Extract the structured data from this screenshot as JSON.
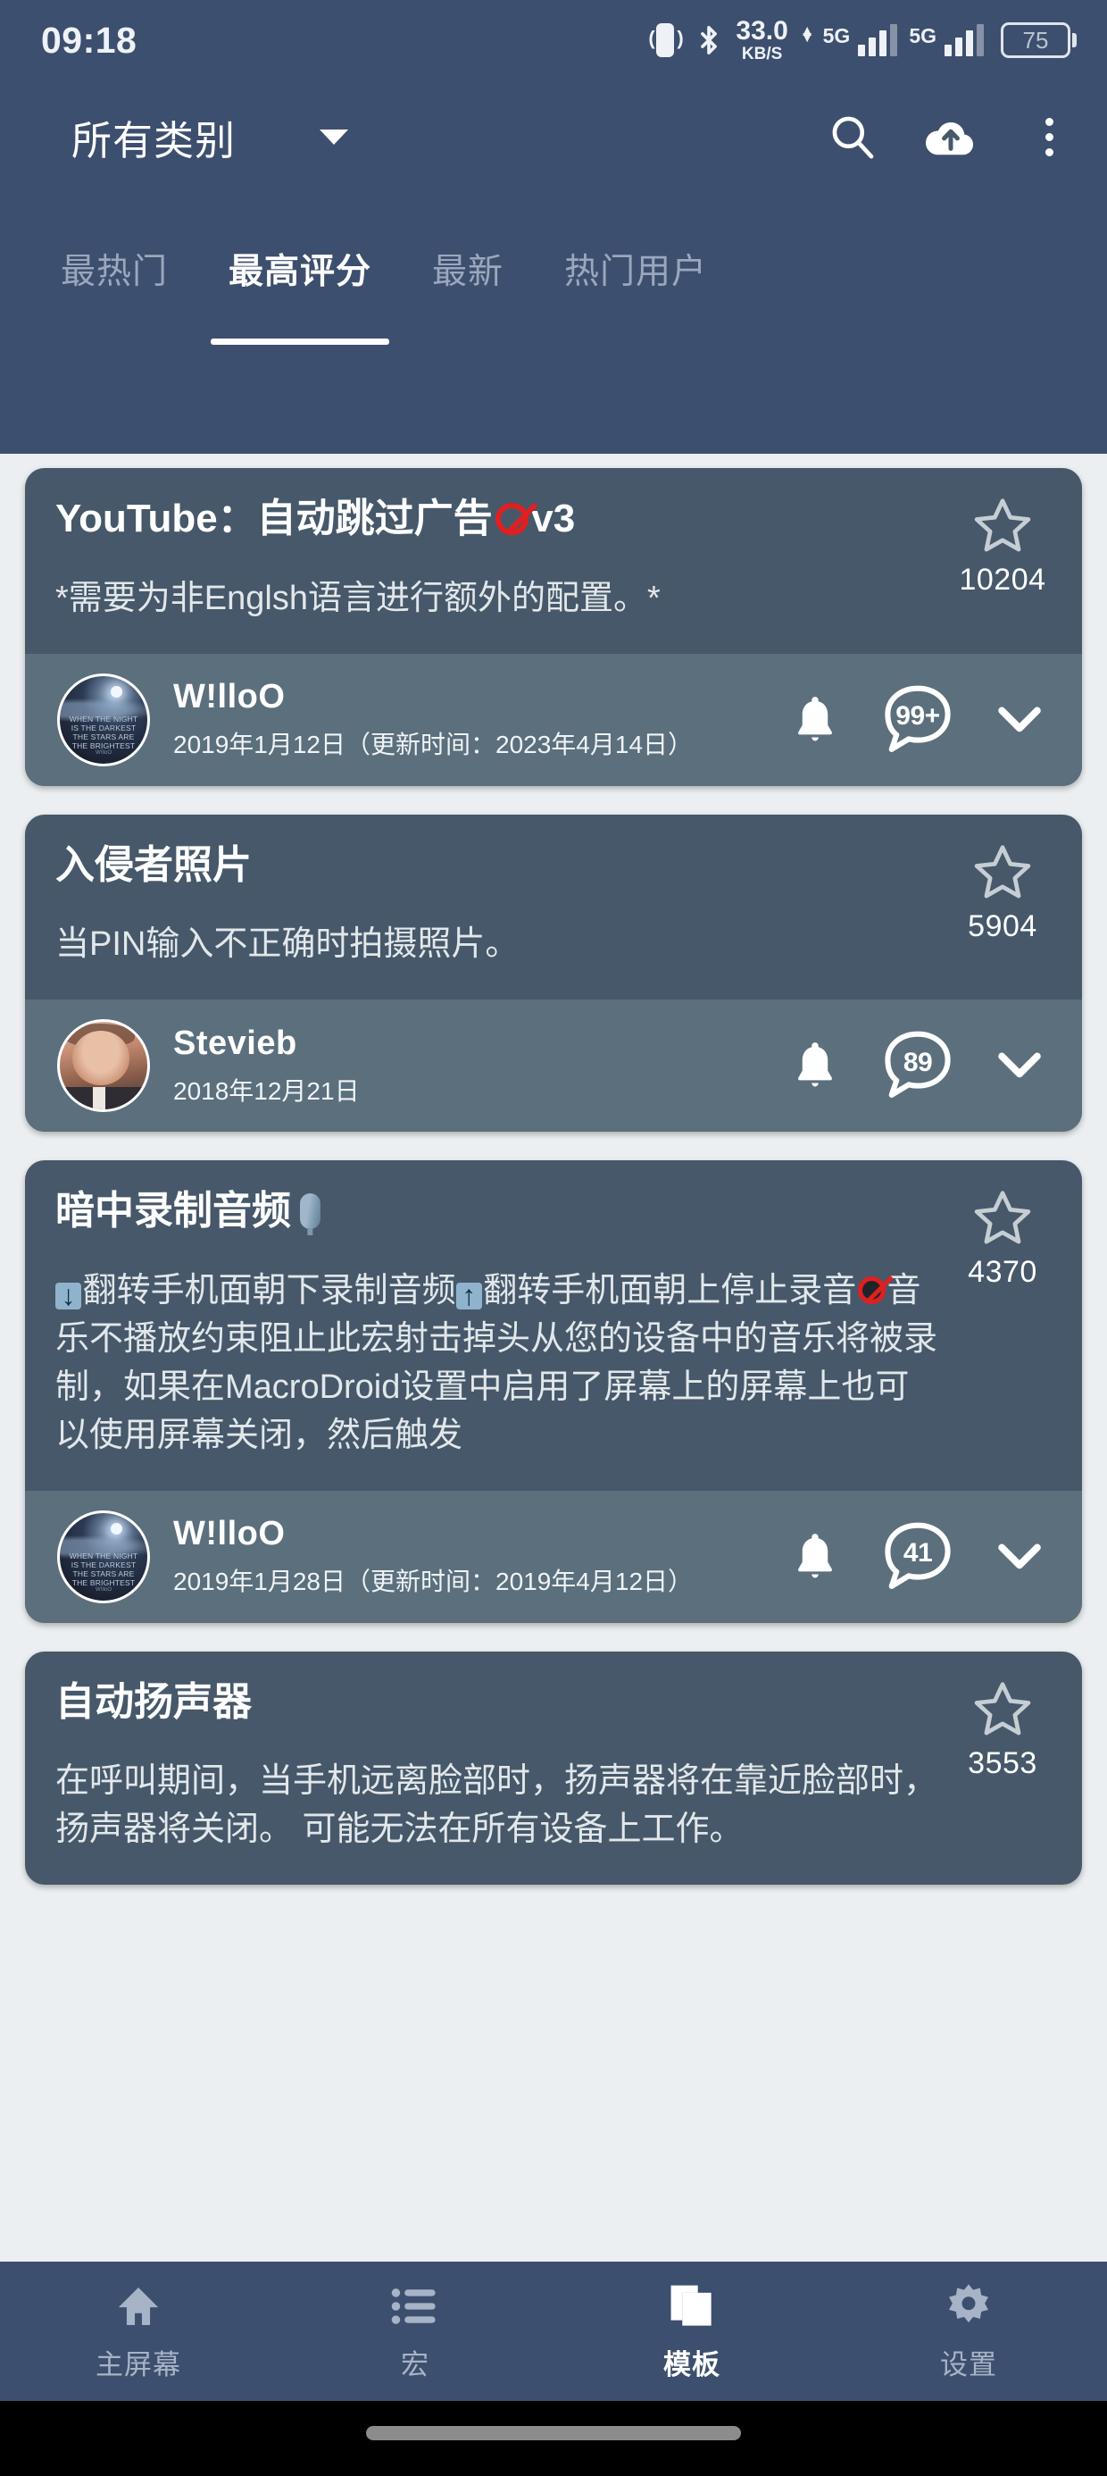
{
  "status_bar": {
    "clock": "09:18",
    "network_speed_value": "33.0",
    "network_speed_unit": "KB/S",
    "sim1_network": "5G",
    "sim2_network": "5G",
    "battery_percent": "75",
    "icons": [
      "vibrate-icon",
      "bluetooth-icon",
      "signal-icon",
      "battery-icon"
    ]
  },
  "toolbar": {
    "category": "所有类别",
    "dropdown_icon": "chevron-down-icon",
    "search_icon": "search-icon",
    "upload_icon": "cloud-upload-icon",
    "overflow_icon": "more-vertical-icon"
  },
  "tabs": [
    {
      "label": "最热门",
      "active": false
    },
    {
      "label": "最高评分",
      "active": true
    },
    {
      "label": "最新",
      "active": false
    },
    {
      "label": "热门用户",
      "active": false
    }
  ],
  "cards": [
    {
      "title_parts": [
        {
          "type": "text",
          "value": "YouTube：自动跳过广告"
        },
        {
          "type": "emoji",
          "value": "no-entry-emoji"
        },
        {
          "type": "text",
          "value": "v3"
        }
      ],
      "title_plain": "YouTube：自动跳过广告🚫v3",
      "description": "*需要为非Englsh语言进行额外的配置。*",
      "rating_icon": "star-outline-icon",
      "rating_count": "10204",
      "author": {
        "name": "W!lloO",
        "avatar": "night-sky-avatar",
        "avatar_caption": "WHEN THE NIGHT IS THE DARKEST THE STARS ARE THE BRIGHTEST",
        "date": "2019年1月12日（更新时间：2023年4月14日）",
        "bell_icon": "bell-icon",
        "comment_icon": "comment-bubble-icon",
        "comment_count": "99+",
        "expand_icon": "chevron-down-icon"
      }
    },
    {
      "title_parts": [
        {
          "type": "text",
          "value": "入侵者照片"
        }
      ],
      "title_plain": "入侵者照片",
      "description": "当PIN输入不正确时拍摄照片。",
      "rating_icon": "star-outline-icon",
      "rating_count": "5904",
      "author": {
        "name": "Stevieb",
        "avatar": "photo-avatar",
        "date": "2018年12月21日",
        "bell_icon": "bell-icon",
        "comment_icon": "comment-bubble-icon",
        "comment_count": "89",
        "expand_icon": "chevron-down-icon"
      }
    },
    {
      "title_parts": [
        {
          "type": "text",
          "value": "暗中录制音频"
        },
        {
          "type": "emoji",
          "value": "microphone-emoji"
        }
      ],
      "title_plain": "暗中录制音频🎙",
      "description": "⤵翻转手机面朝下录制音频⤴翻转手机面朝上停止录音🚫音乐不播放约束阻止此宏射击掉头从您的设备中的音乐将被录制，如果在MacroDroid设置中启用了屏幕上的屏幕上也可以使用屏幕关闭，然后触发",
      "description_parts": [
        {
          "type": "emoji",
          "value": "arrow-down-emoji",
          "glyph": "↓"
        },
        {
          "type": "text",
          "value": "翻转手机面朝下录制音频"
        },
        {
          "type": "emoji",
          "value": "arrow-up-emoji",
          "glyph": "↑"
        },
        {
          "type": "text",
          "value": "翻转手机面朝上停止录音"
        },
        {
          "type": "emoji",
          "value": "no-sound-emoji"
        },
        {
          "type": "text",
          "value": "音乐不播放约束阻止此宏射击掉头从您的设备中的音乐将被录制，如果在MacroDroid设置中启用了屏幕上的屏幕上也可以使用屏幕关闭，然后触发"
        }
      ],
      "rating_icon": "star-outline-icon",
      "rating_count": "4370",
      "author": {
        "name": "W!lloO",
        "avatar": "night-sky-avatar",
        "avatar_caption": "WHEN THE NIGHT IS THE DARKEST THE STARS ARE THE BRIGHTEST",
        "date": "2019年1月28日（更新时间：2019年4月12日）",
        "bell_icon": "bell-icon",
        "comment_icon": "comment-bubble-icon",
        "comment_count": "41",
        "expand_icon": "chevron-down-icon"
      }
    },
    {
      "title_parts": [
        {
          "type": "text",
          "value": "自动扬声器"
        }
      ],
      "title_plain": "自动扬声器",
      "description": "在呼叫期间，当手机远离脸部时，扬声器将在靠近脸部时，扬声器将关闭。 可能无法在所有设备上工作。",
      "rating_icon": "star-outline-icon",
      "rating_count": "3553"
    }
  ],
  "bottom_nav": [
    {
      "label": "主屏幕",
      "icon": "home-icon",
      "active": false
    },
    {
      "label": "宏",
      "icon": "list-icon",
      "active": false
    },
    {
      "label": "模板",
      "icon": "templates-icon",
      "active": true
    },
    {
      "label": "设置",
      "icon": "gear-icon",
      "active": false
    }
  ],
  "colors": {
    "header": "#3d4f6e",
    "page_background": "#eceff1",
    "card": "#46586a",
    "author_row": "#5b6f7d",
    "accent_text": "#ffffff",
    "inactive_text": "#a7b3c6",
    "emoji_red": "#e02020"
  }
}
